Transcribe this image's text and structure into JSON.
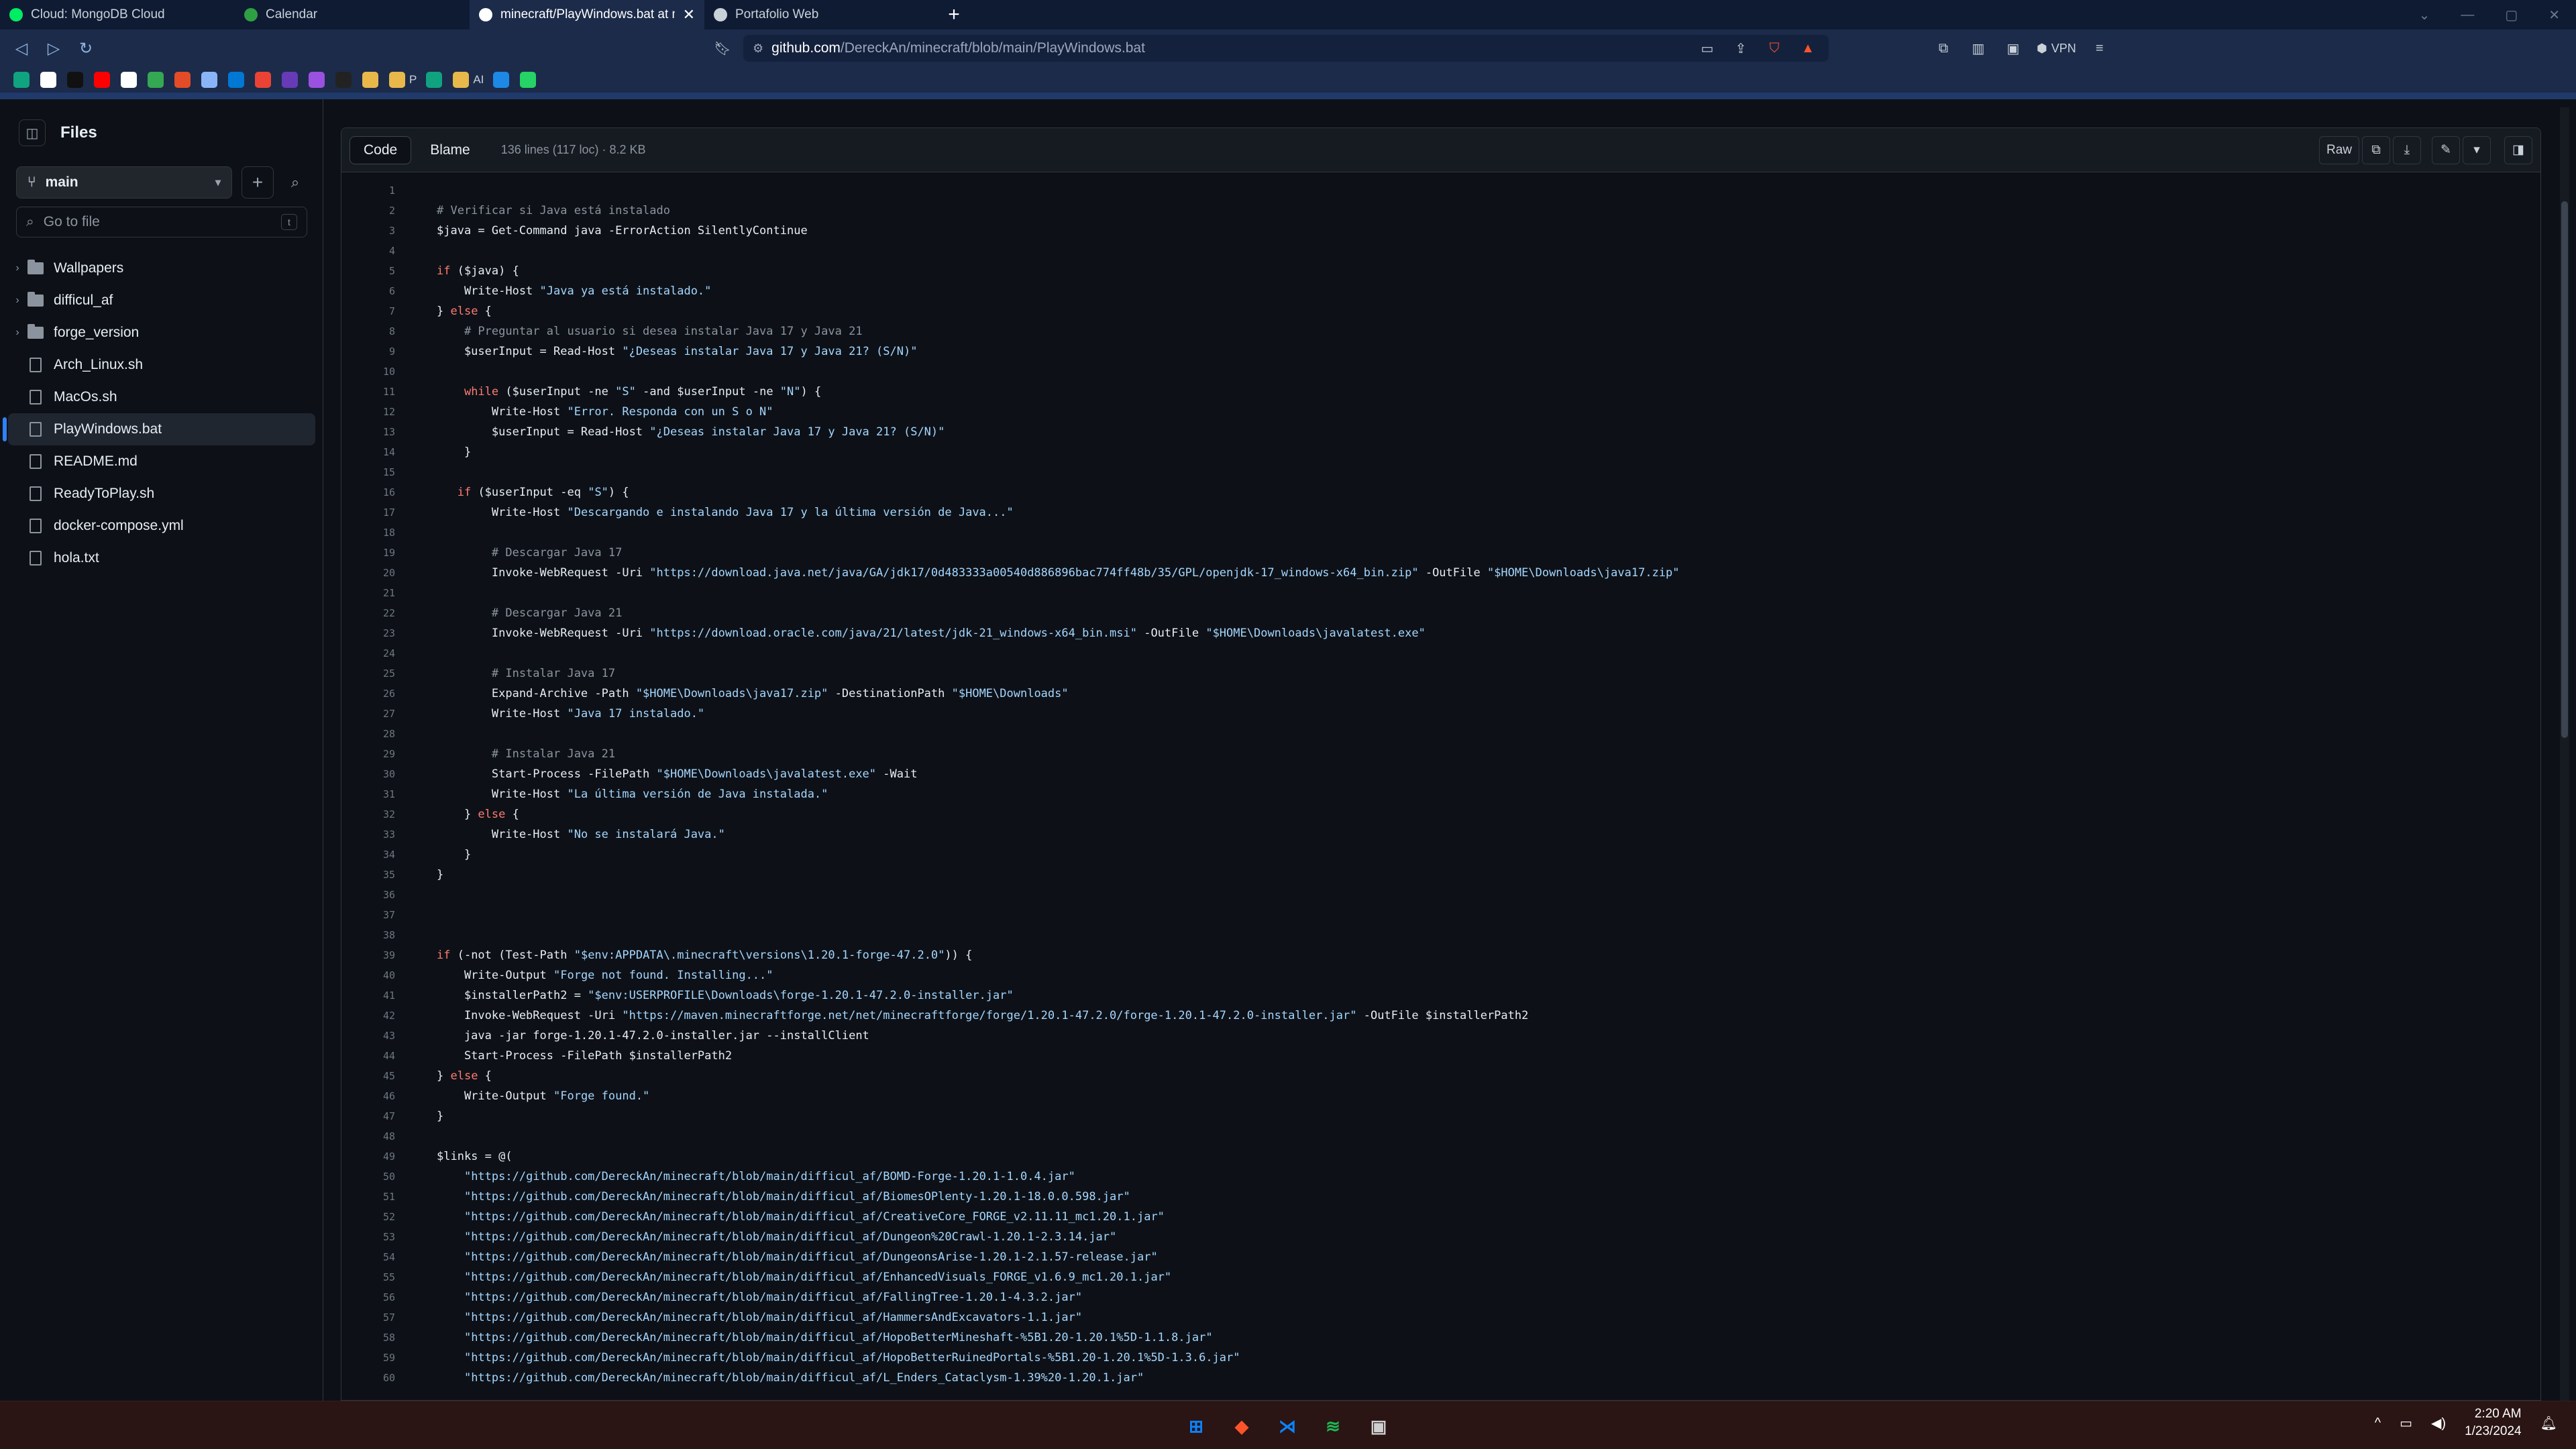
{
  "browser": {
    "tabs": [
      {
        "title": "Cloud: MongoDB Cloud",
        "icon": "mongodb-leaf-icon",
        "color": "#00ed64",
        "active": false
      },
      {
        "title": "Calendar",
        "icon": "calendar-icon",
        "color": "#2ea043",
        "active": false
      },
      {
        "title": "minecraft/PlayWindows.bat at m",
        "icon": "github-icon",
        "color": "#ffffff",
        "active": true
      },
      {
        "title": "Portafolio Web",
        "icon": "globe-icon",
        "color": "#c9d1d9",
        "active": false
      }
    ],
    "new_tab": "+",
    "url_host": "github.com",
    "url_path": "/DereckAn/minecraft/blob/main/PlayWindows.bat",
    "vpn_label": "VPN",
    "bookmarks": [
      {
        "label": "",
        "icon": "chatgpt-icon",
        "color": "#10a37f"
      },
      {
        "label": "",
        "icon": "notion-icon",
        "color": "#ffffff"
      },
      {
        "label": "",
        "icon": "bookmark-b-icon",
        "color": "#111111"
      },
      {
        "label": "",
        "icon": "youtube-icon",
        "color": "#ff0000"
      },
      {
        "label": "",
        "icon": "github-icon",
        "color": "#ffffff"
      },
      {
        "label": "",
        "icon": "maps-icon",
        "color": "#34a853"
      },
      {
        "label": "",
        "icon": "a-icon",
        "color": "#e34c26"
      },
      {
        "label": "",
        "icon": "gemini-icon",
        "color": "#8ab4f8"
      },
      {
        "label": "",
        "icon": "outlook-icon",
        "color": "#0078d4"
      },
      {
        "label": "",
        "icon": "gmail-icon",
        "color": "#ea4335"
      },
      {
        "label": "",
        "icon": "forms-icon",
        "color": "#673ab7"
      },
      {
        "label": "",
        "icon": "d-icon",
        "color": "#9b51e0"
      },
      {
        "label": "",
        "icon": "terminal-icon",
        "color": "#222222"
      },
      {
        "label": "",
        "icon": "folder-icon",
        "color": "#e8b84a"
      },
      {
        "label": "P",
        "icon": "folder-icon",
        "color": "#e8b84a"
      },
      {
        "label": "",
        "icon": "chatgpt-icon",
        "color": "#10a37f"
      },
      {
        "label": "AI",
        "icon": "folder-icon",
        "color": "#e8b84a"
      },
      {
        "label": "",
        "icon": "c-icon",
        "color": "#1e88e5"
      },
      {
        "label": "",
        "icon": "whatsapp-icon",
        "color": "#25d366"
      }
    ]
  },
  "sidebar": {
    "title": "Files",
    "branch": "main",
    "search_placeholder": "Go to file",
    "search_shortcut": "t",
    "items": [
      {
        "name": "Wallpapers",
        "type": "folder"
      },
      {
        "name": "difficul_af",
        "type": "folder"
      },
      {
        "name": "forge_version",
        "type": "folder"
      },
      {
        "name": "Arch_Linux.sh",
        "type": "file"
      },
      {
        "name": "MacOs.sh",
        "type": "file"
      },
      {
        "name": "PlayWindows.bat",
        "type": "file",
        "selected": true
      },
      {
        "name": "README.md",
        "type": "file"
      },
      {
        "name": "ReadyToPlay.sh",
        "type": "file"
      },
      {
        "name": "docker-compose.yml",
        "type": "file"
      },
      {
        "name": "hola.txt",
        "type": "file"
      }
    ]
  },
  "code_view": {
    "tab_code": "Code",
    "tab_blame": "Blame",
    "meta": "136 lines (117 loc) · 8.2 KB",
    "raw_label": "Raw",
    "lines": [
      "",
      "# Verificar si Java está instalado",
      "$java = Get-Command java -ErrorAction SilentlyContinue",
      "",
      "if ($java) {",
      "    Write-Host \"Java ya está instalado.\"",
      "} else {",
      "    # Preguntar al usuario si desea instalar Java 17 y Java 21",
      "    $userInput = Read-Host \"¿Deseas instalar Java 17 y Java 21? (S/N)\"",
      "",
      "    while ($userInput -ne \"S\" -and $userInput -ne \"N\") {",
      "        Write-Host \"Error. Responda con un S o N\"",
      "        $userInput = Read-Host \"¿Deseas instalar Java 17 y Java 21? (S/N)\"",
      "    }",
      "",
      "   if ($userInput -eq \"S\") {",
      "        Write-Host \"Descargando e instalando Java 17 y la última versión de Java...\"",
      "",
      "        # Descargar Java 17",
      "        Invoke-WebRequest -Uri \"https://download.java.net/java/GA/jdk17/0d483333a00540d886896bac774ff48b/35/GPL/openjdk-17_windows-x64_bin.zip\" -OutFile \"$HOME\\Downloads\\java17.zip\"",
      "",
      "        # Descargar Java 21",
      "        Invoke-WebRequest -Uri \"https://download.oracle.com/java/21/latest/jdk-21_windows-x64_bin.msi\" -OutFile \"$HOME\\Downloads\\javalatest.exe\"",
      "",
      "        # Instalar Java 17",
      "        Expand-Archive -Path \"$HOME\\Downloads\\java17.zip\" -DestinationPath \"$HOME\\Downloads\"",
      "        Write-Host \"Java 17 instalado.\"",
      "",
      "        # Instalar Java 21",
      "        Start-Process -FilePath \"$HOME\\Downloads\\javalatest.exe\" -Wait",
      "        Write-Host \"La última versión de Java instalada.\"",
      "    } else {",
      "        Write-Host \"No se instalará Java.\"",
      "    }",
      "}",
      "",
      "",
      "",
      "if (-not (Test-Path \"$env:APPDATA\\.minecraft\\versions\\1.20.1-forge-47.2.0\")) {",
      "    Write-Output \"Forge not found. Installing...\"",
      "    $installerPath2 = \"$env:USERPROFILE\\Downloads\\forge-1.20.1-47.2.0-installer.jar\"",
      "    Invoke-WebRequest -Uri \"https://maven.minecraftforge.net/net/minecraftforge/forge/1.20.1-47.2.0/forge-1.20.1-47.2.0-installer.jar\" -OutFile $installerPath2",
      "    java -jar forge-1.20.1-47.2.0-installer.jar --installClient",
      "    Start-Process -FilePath $installerPath2",
      "} else {",
      "    Write-Output \"Forge found.\"",
      "}",
      "",
      "$links = @(",
      "    \"https://github.com/DereckAn/minecraft/blob/main/difficul_af/BOMD-Forge-1.20.1-1.0.4.jar\"",
      "    \"https://github.com/DereckAn/minecraft/blob/main/difficul_af/BiomesOPlenty-1.20.1-18.0.0.598.jar\"",
      "    \"https://github.com/DereckAn/minecraft/blob/main/difficul_af/CreativeCore_FORGE_v2.11.11_mc1.20.1.jar\"",
      "    \"https://github.com/DereckAn/minecraft/blob/main/difficul_af/Dungeon%20Crawl-1.20.1-2.3.14.jar\"",
      "    \"https://github.com/DereckAn/minecraft/blob/main/difficul_af/DungeonsArise-1.20.1-2.1.57-release.jar\"",
      "    \"https://github.com/DereckAn/minecraft/blob/main/difficul_af/EnhancedVisuals_FORGE_v1.6.9_mc1.20.1.jar\"",
      "    \"https://github.com/DereckAn/minecraft/blob/main/difficul_af/FallingTree-1.20.1-4.3.2.jar\"",
      "    \"https://github.com/DereckAn/minecraft/blob/main/difficul_af/HammersAndExcavators-1.1.jar\"",
      "    \"https://github.com/DereckAn/minecraft/blob/main/difficul_af/HopoBetterMineshaft-%5B1.20-1.20.1%5D-1.1.8.jar\"",
      "    \"https://github.com/DereckAn/minecraft/blob/main/difficul_af/HopoBetterRuinedPortals-%5B1.20-1.20.1%5D-1.3.6.jar\"",
      "    \"https://github.com/DereckAn/minecraft/blob/main/difficul_af/L_Enders_Cataclysm-1.39%20-1.20.1.jar\""
    ]
  },
  "taskbar": {
    "apps": [
      {
        "icon": "windows-start-icon",
        "color": "#0a84ff"
      },
      {
        "icon": "brave-icon",
        "color": "#fb542b"
      },
      {
        "icon": "vscode-icon",
        "color": "#0a84ff"
      },
      {
        "icon": "spotify-icon",
        "color": "#1db954"
      },
      {
        "icon": "app-icon",
        "color": "#cfcfcf"
      }
    ],
    "time": "2:20 AM",
    "date": "1/23/2024"
  }
}
